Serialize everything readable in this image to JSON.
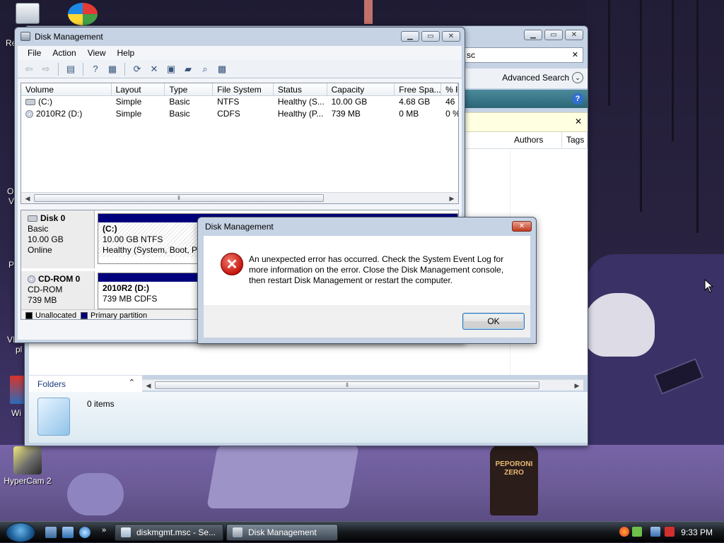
{
  "desktop": {
    "icons": [
      {
        "label": "HyperCam 2"
      }
    ],
    "partial_labels": [
      "Re",
      "O",
      "V",
      "P",
      "VI",
      "pl",
      "Wi"
    ],
    "bottle_label": "PEPORONI ZERO"
  },
  "explorer": {
    "search_text": "sc",
    "advanced_search_label": "Advanced Search",
    "columns": [
      "Authors",
      "Tags"
    ],
    "folders_label": "Folders",
    "items_count": "0 items"
  },
  "disk_mgmt": {
    "title": "Disk Management",
    "menu": [
      "File",
      "Action",
      "View",
      "Help"
    ],
    "columns": [
      "Volume",
      "Layout",
      "Type",
      "File System",
      "Status",
      "Capacity",
      "Free Spa...",
      "% F"
    ],
    "rows": [
      {
        "volume": "(C:)",
        "layout": "Simple",
        "type": "Basic",
        "fs": "NTFS",
        "status": "Healthy (S...",
        "capacity": "10.00 GB",
        "free": "4.68 GB",
        "pct": "46"
      },
      {
        "volume": "2010R2 (D:)",
        "layout": "Simple",
        "type": "Basic",
        "fs": "CDFS",
        "status": "Healthy (P...",
        "capacity": "739 MB",
        "free": "0 MB",
        "pct": "0 %"
      }
    ],
    "disks": [
      {
        "name": "Disk 0",
        "kind": "Basic",
        "size": "10.00 GB",
        "state": "Online",
        "partition": {
          "label": "(C:)",
          "size": "10.00 GB NTFS",
          "status": "Healthy (System, Boot, Pa"
        }
      },
      {
        "name": "CD-ROM 0",
        "kind": "CD-ROM",
        "size": "739 MB",
        "partition": {
          "label": "2010R2  (D:)",
          "size": "739 MB CDFS"
        }
      }
    ],
    "legend": [
      "Unallocated",
      "Primary partition"
    ],
    "colors": {
      "primary_partition": "#00007d",
      "unallocated": "#000000"
    }
  },
  "dialog": {
    "title": "Disk Management",
    "message": "An unexpected error has occurred. Check the System Event Log for more information on the error. Close the Disk Management console, then restart Disk Management or restart the computer.",
    "ok_label": "OK",
    "icon": "error-icon"
  },
  "taskbar": {
    "tasks": [
      {
        "label": "diskmgmt.msc - Se..."
      },
      {
        "label": "Disk Management"
      }
    ],
    "clock": "9:33 PM"
  }
}
